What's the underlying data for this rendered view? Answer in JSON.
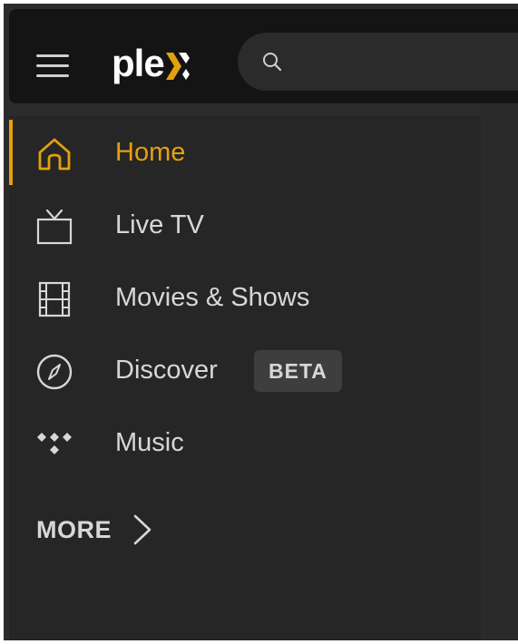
{
  "header": {
    "logo_text": "ple",
    "search": {
      "placeholder": ""
    }
  },
  "sidebar": {
    "items": [
      {
        "label": "Home",
        "icon": "home-icon",
        "active": true
      },
      {
        "label": "Live TV",
        "icon": "tv-icon",
        "active": false
      },
      {
        "label": "Movies & Shows",
        "icon": "film-icon",
        "active": false
      },
      {
        "label": "Discover",
        "icon": "compass-icon",
        "active": false,
        "badge": "BETA"
      },
      {
        "label": "Music",
        "icon": "music-icon",
        "active": false
      }
    ],
    "more_label": "MORE"
  },
  "colors": {
    "accent": "#e5a00d",
    "background": "#262626",
    "topbar": "#141414",
    "text": "#d7d7d7"
  }
}
